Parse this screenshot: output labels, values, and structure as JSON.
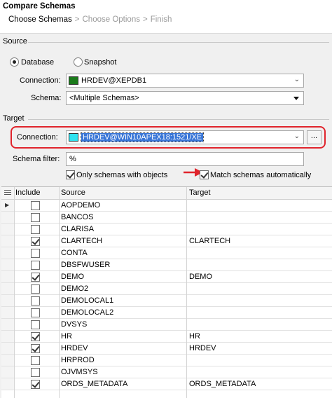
{
  "window": {
    "title": "Compare Schemas",
    "breadcrumbs": [
      {
        "label": "Choose Schemas",
        "state": "active"
      },
      {
        "label": "Choose Options",
        "state": "inactive"
      },
      {
        "label": "Finish",
        "state": "inactive"
      }
    ],
    "breadcrumb_sep": ">"
  },
  "source": {
    "section_label": "Source",
    "radio_database": "Database",
    "radio_snapshot": "Snapshot",
    "selected_radio": "Database",
    "connection_label": "Connection:",
    "connection_value": "HRDEV@XEPDB1",
    "connection_color": "#1a7a1a",
    "schema_label": "Schema:",
    "schema_value": "<Multiple Schemas>"
  },
  "target": {
    "section_label": "Target",
    "connection_label": "Connection:",
    "connection_value": "HRDEV@WIN10APEX18:1521/XE",
    "connection_color": "#2fe3f0",
    "schema_filter_label": "Schema filter:",
    "schema_filter_value": "%",
    "only_with_objects_label": "Only schemas with objects",
    "only_with_objects_checked": true,
    "match_auto_label": "Match schemas automatically",
    "match_auto_checked": true,
    "dots_label": "..."
  },
  "table": {
    "columns": [
      "Include",
      "Source",
      "Target"
    ],
    "rows": [
      {
        "include": false,
        "source": "AOPDEMO",
        "target": ""
      },
      {
        "include": false,
        "source": "BANCOS",
        "target": ""
      },
      {
        "include": false,
        "source": "CLARISA",
        "target": ""
      },
      {
        "include": true,
        "source": "CLARTECH",
        "target": "CLARTECH"
      },
      {
        "include": false,
        "source": "CONTA",
        "target": ""
      },
      {
        "include": false,
        "source": "DBSFWUSER",
        "target": ""
      },
      {
        "include": true,
        "source": "DEMO",
        "target": "DEMO"
      },
      {
        "include": false,
        "source": "DEMO2",
        "target": ""
      },
      {
        "include": false,
        "source": "DEMOLOCAL1",
        "target": ""
      },
      {
        "include": false,
        "source": "DEMOLOCAL2",
        "target": ""
      },
      {
        "include": false,
        "source": "DVSYS",
        "target": ""
      },
      {
        "include": true,
        "source": "HR",
        "target": "HR"
      },
      {
        "include": true,
        "source": "HRDEV",
        "target": "HRDEV"
      },
      {
        "include": false,
        "source": "HRPROD",
        "target": ""
      },
      {
        "include": false,
        "source": "OJVMSYS",
        "target": ""
      },
      {
        "include": true,
        "source": "ORDS_METADATA",
        "target": "ORDS_METADATA"
      }
    ],
    "current_row_marker": "▶"
  },
  "colors": {
    "highlight": "#e0242c",
    "arrow": "#e0242c"
  }
}
